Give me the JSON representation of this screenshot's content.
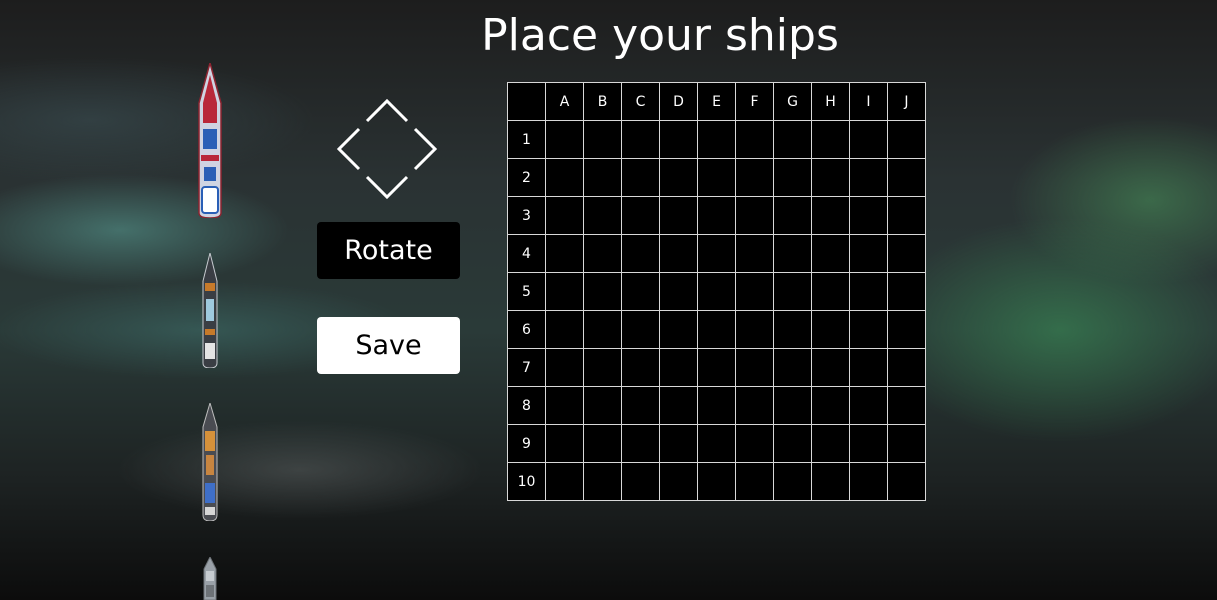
{
  "title": "Place your ships",
  "controls": {
    "rotate_label": "Rotate",
    "save_label": "Save",
    "rotate_icon": "diamond-arrows-icon"
  },
  "board": {
    "columns": [
      "A",
      "B",
      "C",
      "D",
      "E",
      "F",
      "G",
      "H",
      "I",
      "J"
    ],
    "rows": [
      "1",
      "2",
      "3",
      "4",
      "5",
      "6",
      "7",
      "8",
      "9",
      "10"
    ]
  },
  "ships": [
    {
      "name": "carrier",
      "colors": {
        "hull": "#cfd4e2",
        "trim": "#b9283a",
        "accent": "#2a5fb6"
      }
    },
    {
      "name": "battleship",
      "colors": {
        "hull": "#3a3e44",
        "trim": "#c77a2a",
        "accent": "#9fc9de"
      }
    },
    {
      "name": "cruiser",
      "colors": {
        "hull": "#4a4c52",
        "trim": "#d6913a",
        "accent": "#3f6fc8"
      }
    },
    {
      "name": "submarine",
      "colors": {
        "hull": "#9aa1a8",
        "trim": "#6e7378",
        "accent": "#c7ccd1"
      }
    }
  ]
}
